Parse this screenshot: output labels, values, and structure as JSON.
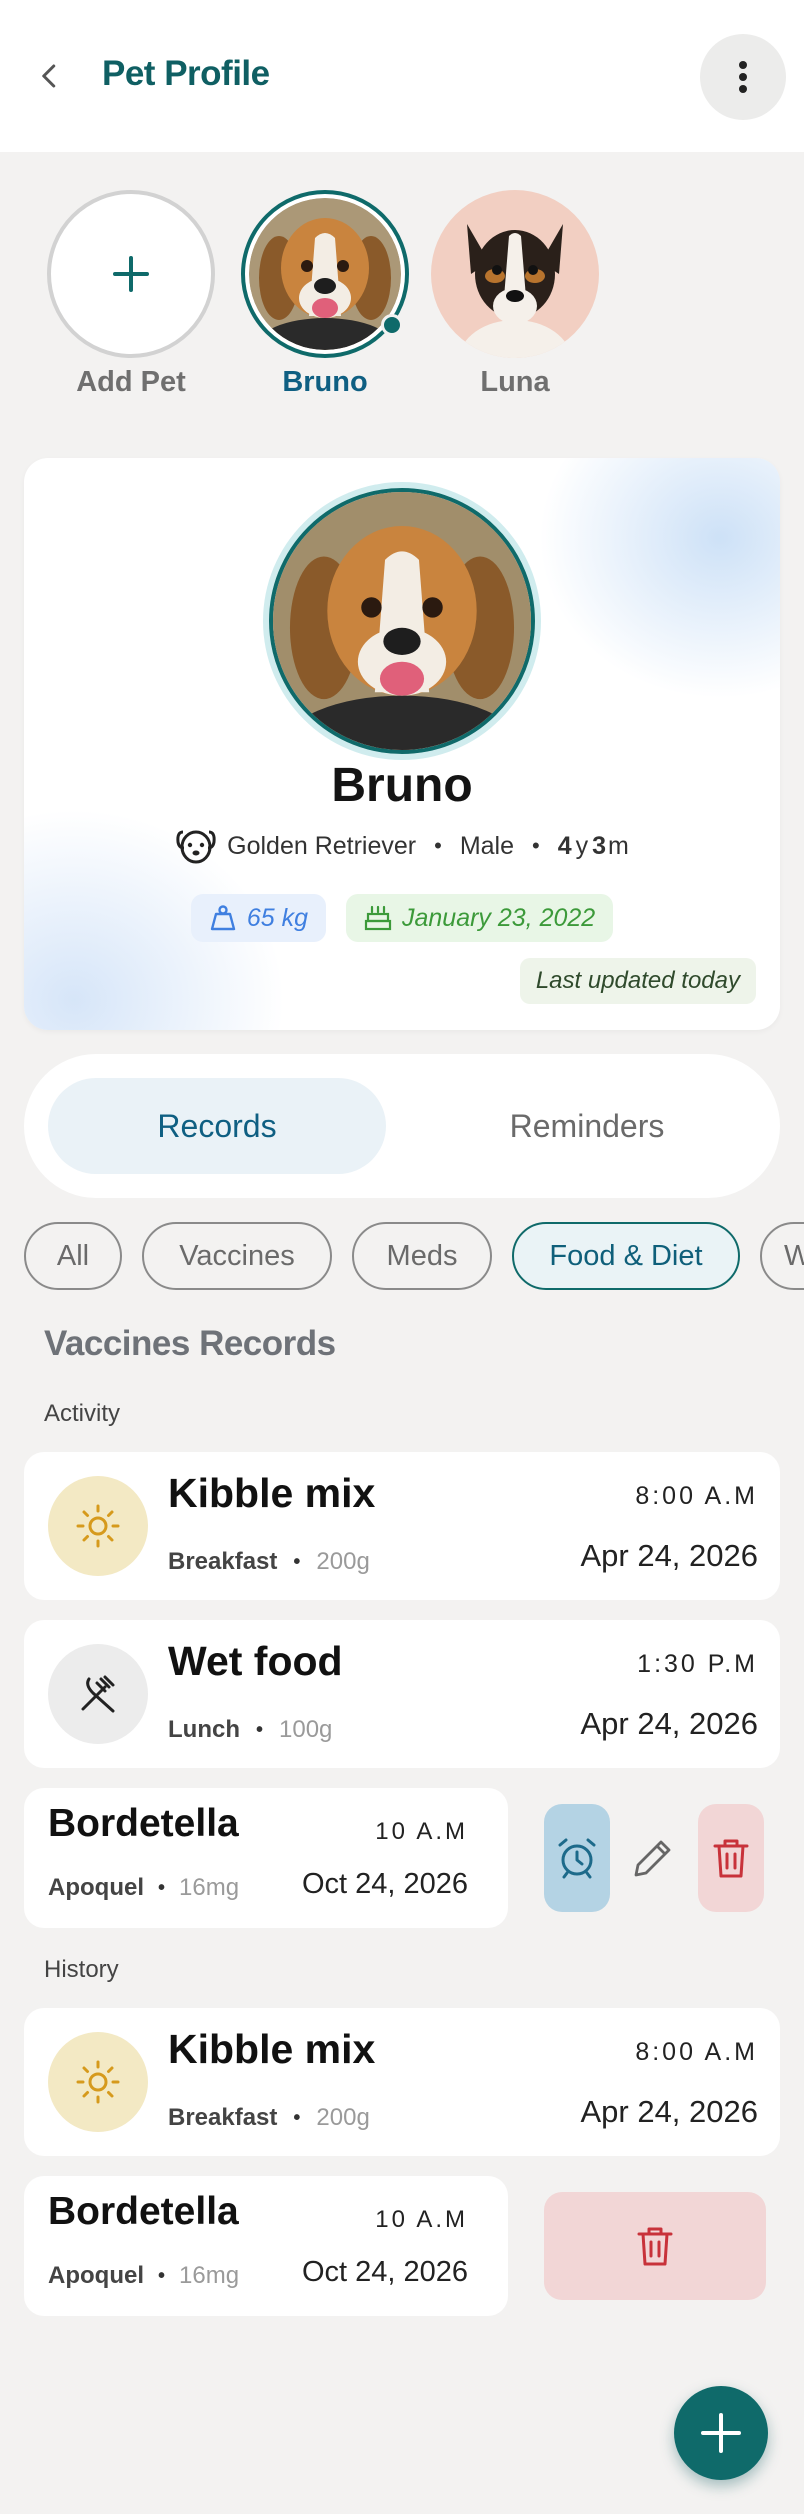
{
  "header": {
    "title": "Pet Profile",
    "back_icon": "chevron-left-icon",
    "menu_icon": "more-vertical-icon"
  },
  "pets": {
    "add_label": "Add Pet",
    "items": [
      {
        "name": "Bruno",
        "selected": true
      },
      {
        "name": "Luna",
        "selected": false
      }
    ]
  },
  "profile": {
    "name": "Bruno",
    "breed": "Golden Retriever",
    "sex": "Male",
    "age_years": "4",
    "age_years_unit": "y",
    "age_months": "3",
    "age_months_unit": "m",
    "weight": "65 kg",
    "birthday": "January 23, 2022",
    "updated": "Last updated today"
  },
  "tabs": {
    "records": "Records",
    "reminders": "Reminders",
    "active": "Records"
  },
  "filters": {
    "items": [
      "All",
      "Vaccines",
      "Meds",
      "Food & Diet",
      "W"
    ],
    "active": "Food & Diet"
  },
  "section": {
    "title": "Vaccines Records",
    "activity_label": "Activity",
    "history_label": "History"
  },
  "activity": [
    {
      "title": "Kibble mix",
      "meal": "Breakfast",
      "qty": "200g",
      "time": "8:00 A.M",
      "date": "Apr 24, 2026",
      "icon": "sun-icon"
    },
    {
      "title": "Wet food",
      "meal": "Lunch",
      "qty": "100g",
      "time": "1:30 P.M",
      "date": "Apr 24, 2026",
      "icon": "fork-knife-icon"
    }
  ],
  "activity_swiped": {
    "title": "Bordetella",
    "med": "Apoquel",
    "qty": "16mg",
    "time": "10 A.M",
    "date": "Oct 24, 2026"
  },
  "history": [
    {
      "title": "Kibble mix",
      "meal": "Breakfast",
      "qty": "200g",
      "time": "8:00 A.M",
      "date": "Apr 24, 2026",
      "icon": "sun-icon"
    }
  ],
  "history_swiped": {
    "title": "Bordetella",
    "med": "Apoquel",
    "qty": "16mg",
    "time": "10 A.M",
    "date": "Oct 24, 2026"
  },
  "colors": {
    "primary": "#0f6a6a",
    "accent_blue": "#0f5f82",
    "weight": "#3f7fe0",
    "birthday": "#3c9a3a",
    "danger": "#c8323a"
  }
}
